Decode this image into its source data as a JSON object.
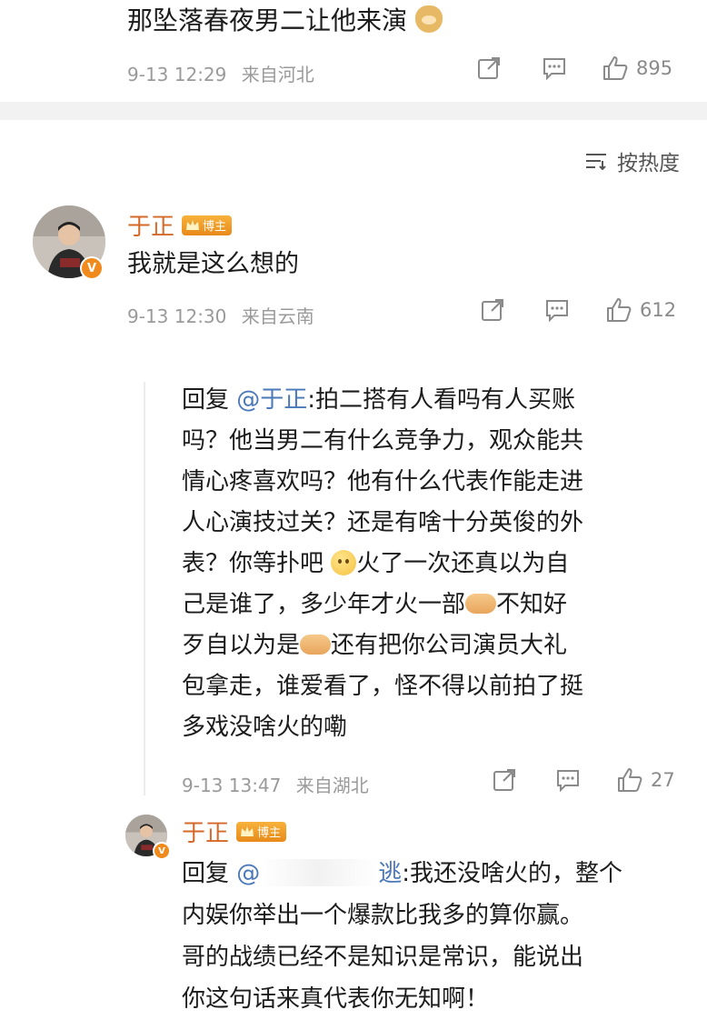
{
  "top_comment": {
    "text": "那坠落春夜男二让他来演",
    "emoji": "doge",
    "timestamp": "9-13 12:29",
    "location": "来自河北",
    "likes": "895"
  },
  "sort": {
    "label": "按热度"
  },
  "main_comment": {
    "username": "于正",
    "badge": "博主",
    "text": "我就是这么想的",
    "timestamp": "9-13 12:30",
    "location": "来自云南",
    "likes": "612"
  },
  "reply_1": {
    "reply_prefix": "回复",
    "mention": "@于正",
    "lines": [
      ":拍二搭有人看吗有人买账",
      "吗？他当男二有什么竞争力，观众能共",
      "情心疼喜欢吗？他有什么代表作能走进",
      "人心演技过关？还是有啥十分英俊的外",
      "表？你等扑吧",
      "火了一次还真以为自",
      "己是谁了，多少年才火一部",
      "不知好",
      "歹自以为是",
      "还有把你公司演员大礼",
      "包拿走，谁爱看了，怪不得以前拍了挺",
      "多戏没啥火的嘞"
    ],
    "timestamp": "9-13 13:47",
    "location": "来自湖北",
    "likes": "27"
  },
  "reply_2": {
    "username": "于正",
    "badge": "博主",
    "reply_prefix": "回复",
    "mention_start": "@",
    "mention_end": "逃",
    "lines": [
      ":我还没啥火的，整个",
      "内娱你举出一个爆款比我多的算你赢。",
      "哥的战绩已经不是知识是常识，能说出",
      "你这句话来真代表你无知啊！"
    ]
  },
  "icons": {
    "share": "share-icon",
    "comment": "comment-icon",
    "like": "thumbs-up-icon",
    "sort": "sort-icon"
  },
  "colors": {
    "username": "#d4692a",
    "mention": "#4a78b8",
    "badge": "#f0a02a"
  }
}
